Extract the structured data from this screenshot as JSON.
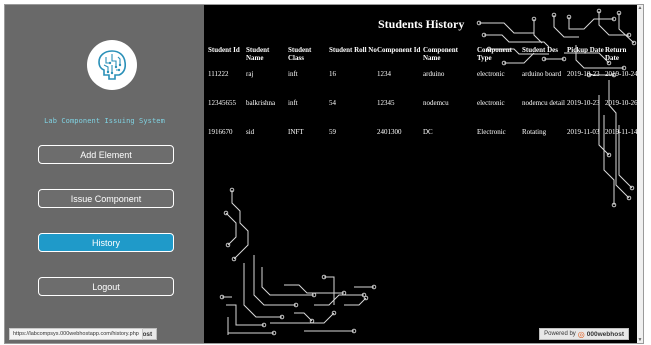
{
  "app": {
    "title": "Lab Component Issuing System"
  },
  "nav": {
    "add_element": "Add Element",
    "issue_component": "Issue Component",
    "history": "History",
    "logout": "Logout"
  },
  "page": {
    "title": "Students History"
  },
  "table": {
    "headers": [
      "Student Id",
      "Student Name",
      "Student Class",
      "Student Roll No",
      "Component Id",
      "Component Name",
      "Component Type",
      "Student Des",
      "Pickup Date",
      "Return Date"
    ],
    "rows": [
      [
        "111222",
        "raj",
        "inft",
        "16",
        "1234",
        "arduino",
        "electronic",
        "arduino board",
        "2019-10-23",
        "2019-10-24"
      ],
      [
        "12345655",
        "balkrishna",
        "inft",
        "54",
        "12345",
        "nodemcu",
        "electronic",
        "nodemcu detail",
        "2019-10-23",
        "2019-10-26"
      ],
      [
        "1916670",
        "sid",
        "INFT",
        "59",
        "2401300",
        "DC",
        "Electronic",
        "Rotating",
        "2019-11-03",
        "2019-11-14"
      ]
    ]
  },
  "footer": {
    "badge_left_brand": "000webhost",
    "badge_right_prefix": "Powered by",
    "badge_right_brand": "000webhost",
    "status_url": "https://labcompsys.000webhostapp.com/history.php"
  },
  "colors": {
    "sidebar_bg": "#696969",
    "main_bg": "#000000",
    "active_button": "#1f9ac9",
    "app_title": "#7fd3e3"
  }
}
